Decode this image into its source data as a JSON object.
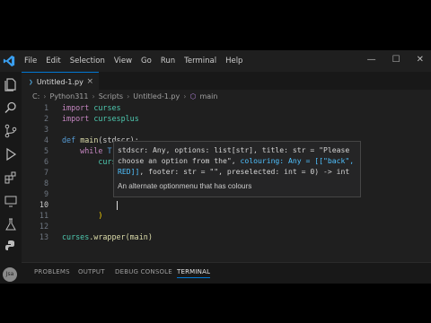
{
  "menu": [
    "File",
    "Edit",
    "Selection",
    "View",
    "Go",
    "Run",
    "Terminal",
    "Help"
  ],
  "tab": {
    "name": "Untitled-1.py",
    "close": "×"
  },
  "breadcrumbs": [
    "C:",
    "Python311",
    "Scripts",
    "Untitled-1.py",
    "main"
  ],
  "code_lines": [
    {
      "n": "1"
    },
    {
      "n": "2"
    },
    {
      "n": "3"
    },
    {
      "n": "4"
    },
    {
      "n": "5"
    },
    {
      "n": "6"
    },
    {
      "n": "7"
    },
    {
      "n": "8"
    },
    {
      "n": "9"
    },
    {
      "n": "10"
    },
    {
      "n": "11"
    },
    {
      "n": "12"
    },
    {
      "n": "13"
    }
  ],
  "code": {
    "l1_kw": "import",
    "l1_mod": "curses",
    "l2_kw": "import",
    "l2_mod": "cursesplus",
    "l4_kw": "def",
    "l4_fn": "main",
    "l4_rest": "(stdscr):",
    "l5_kw": "while",
    "l5_rest": "Tr",
    "l6_rest": "curs",
    "l11_rest": ")",
    "l13_mod": "curses",
    "l13_rest": ".wrapper(main)"
  },
  "hover": {
    "sig1": "stdscr: Any, options: list[str], title: str = \"Please",
    "sig2": "choose an option from the\", ",
    "sig2_hl": "colouring: Any = [[\"back\",",
    "sig3_hl": "RED]]",
    "sig3": ", footer: str = \"\", preselected: int = 0) -> int",
    "doc": "An alternate optionmenu that has colours"
  },
  "panel_tabs": [
    "PROBLEMS",
    "OUTPUT",
    "DEBUG CONSOLE",
    "TERMINAL"
  ],
  "avatar": "Jsa",
  "colors": {
    "accent": "#0078d4",
    "background": "#1f1f1f"
  }
}
